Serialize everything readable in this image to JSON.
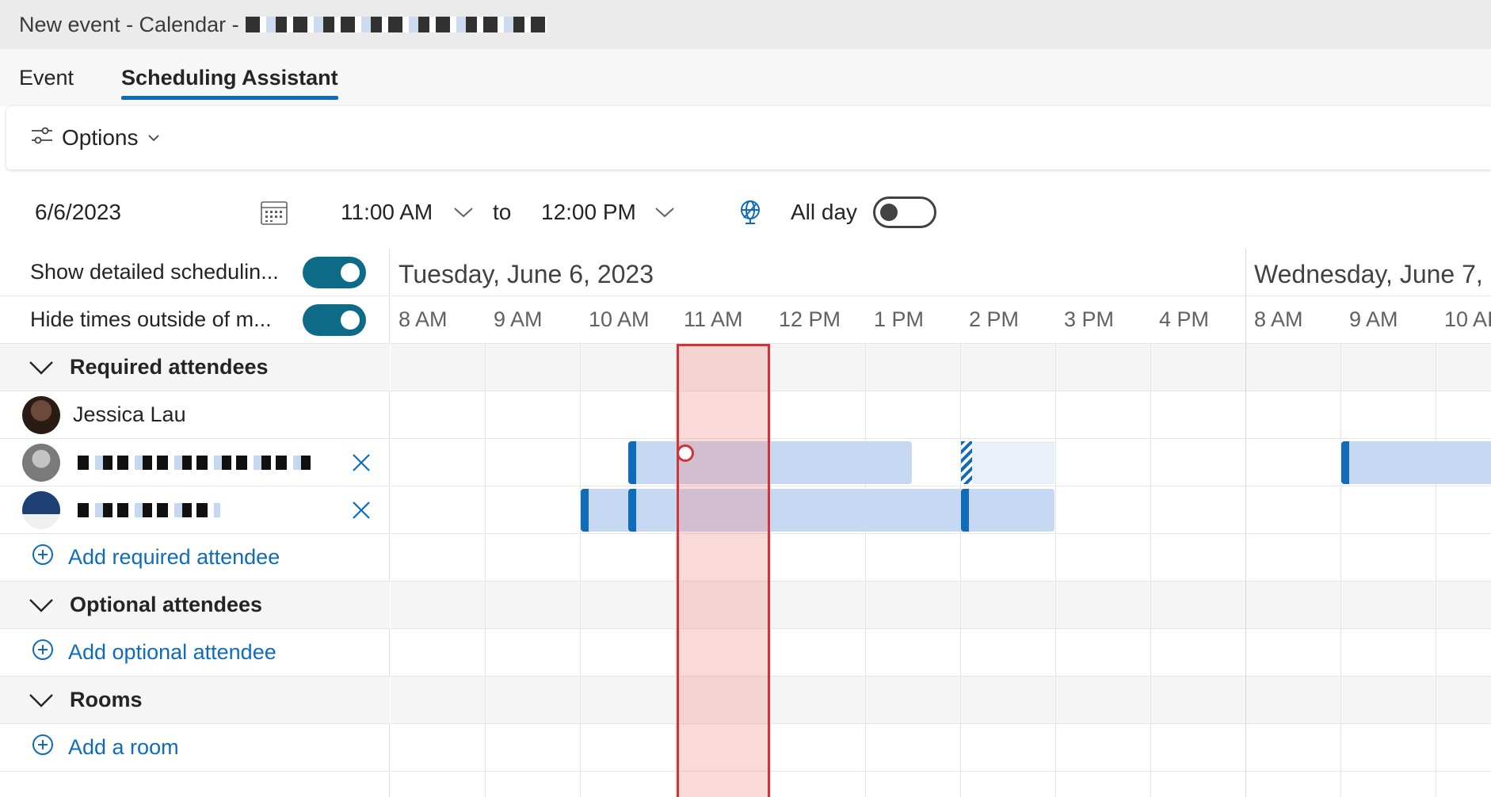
{
  "window": {
    "title": "New event - Calendar - "
  },
  "tabs": [
    {
      "label": "Event",
      "active": false
    },
    {
      "label": "Scheduling Assistant",
      "active": true
    }
  ],
  "toolbar": {
    "options_label": "Options"
  },
  "datetime": {
    "date": "6/6/2023",
    "start_time": "11:00 AM",
    "to_label": "to",
    "end_time": "12:00 PM",
    "all_day_label": "All day",
    "all_day_on": false
  },
  "settings": {
    "show_detailed_label": "Show detailed schedulin...",
    "show_detailed_on": true,
    "hide_times_label": "Hide times outside of m...",
    "hide_times_on": true
  },
  "attendees": {
    "required_header": "Required attendees",
    "people": [
      {
        "name": "Jessica Lau",
        "removable": false
      }
    ],
    "add_required_label": "Add required attendee",
    "optional_header": "Optional attendees",
    "add_optional_label": "Add optional attendee",
    "rooms_header": "Rooms",
    "add_room_label": "Add a room"
  },
  "grid": {
    "days": [
      {
        "label": "Tuesday, June 6, 2023"
      },
      {
        "label": "Wednesday, June 7,"
      }
    ],
    "hours_day1": [
      "8 AM",
      "9 AM",
      "10 AM",
      "11 AM",
      "12 PM",
      "1 PM",
      "2 PM",
      "3 PM",
      "4 PM"
    ],
    "hours_day2": [
      "8 AM",
      "9 AM",
      "10 AI"
    ]
  },
  "colors": {
    "accent": "#0f6cbd",
    "toggle_on": "#0e6b88",
    "busy_fill": "#c7d9f2",
    "selection_border": "#d13438"
  }
}
